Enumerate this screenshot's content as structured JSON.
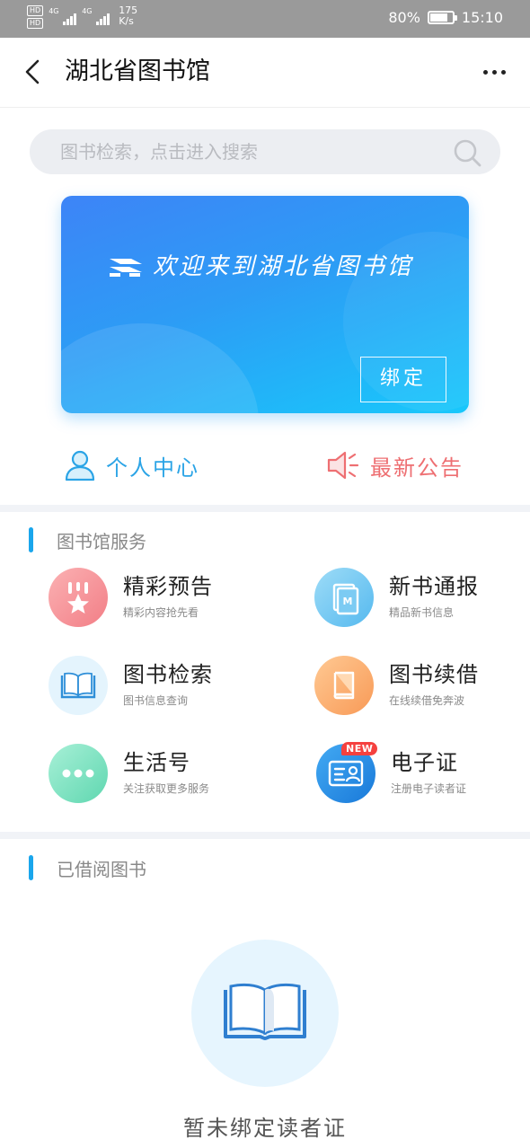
{
  "status_bar": {
    "hd1": "HD",
    "hd2": "HD",
    "net1": "4G",
    "net2": "4G",
    "speed_value": "175",
    "speed_unit": "K/s",
    "battery": "80%",
    "battery_level": 0.8,
    "time": "15:10"
  },
  "nav": {
    "title": "湖北省图书馆"
  },
  "search": {
    "placeholder": "图书检索，点击进入搜索"
  },
  "banner": {
    "welcome": "欢迎来到湖北省图书馆",
    "bind_label": "绑定"
  },
  "quick_links": {
    "personal": "个人中心",
    "notice": "最新公告"
  },
  "services": {
    "title": "图书馆服务",
    "items": [
      {
        "name": "精彩预告",
        "desc": "精彩内容抢先看"
      },
      {
        "name": "新书通报",
        "desc": "精品新书信息"
      },
      {
        "name": "图书检索",
        "desc": "图书信息查询"
      },
      {
        "name": "图书续借",
        "desc": "在线续借免奔波"
      },
      {
        "name": "生活号",
        "desc": "关注获取更多服务"
      },
      {
        "name": "电子证",
        "desc": "注册电子读者证",
        "badge": "NEW"
      }
    ]
  },
  "borrowed": {
    "title": "已借阅图书",
    "empty_text": "暂未绑定读者证"
  },
  "colors": {
    "accent_blue": "#1aa6ec",
    "notice_red": "#ee6f72",
    "banner_start": "#3d84f7",
    "banner_end": "#18c8fb"
  }
}
